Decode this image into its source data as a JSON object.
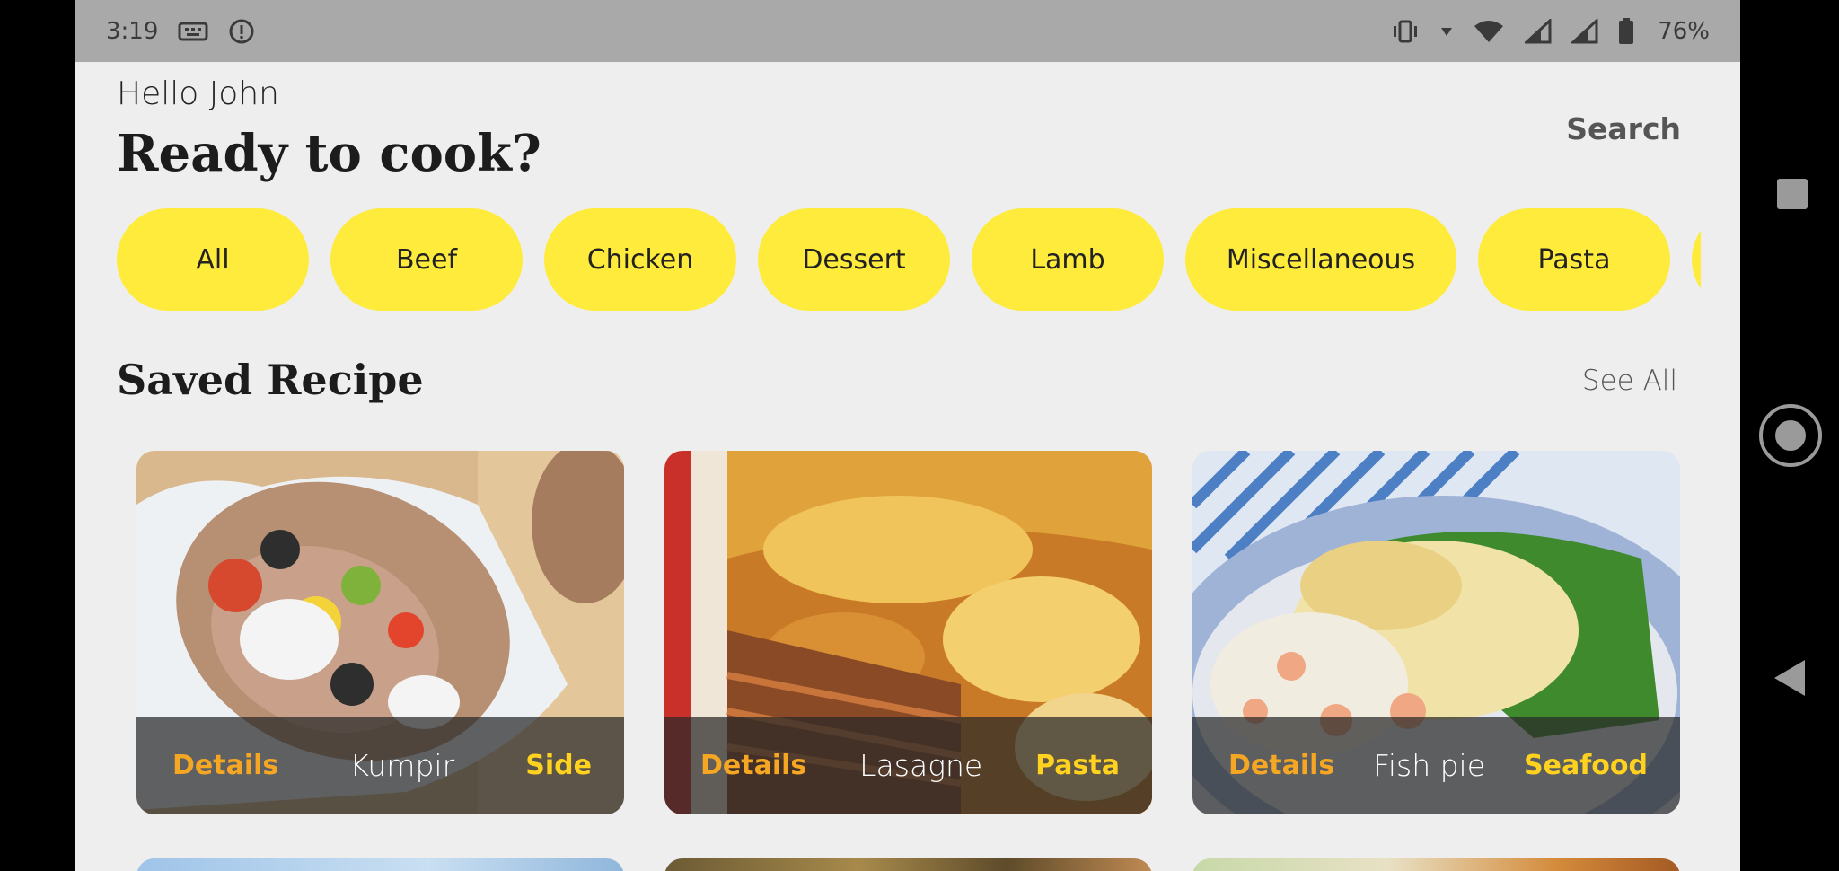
{
  "status_bar": {
    "time": "3:19",
    "battery_percent": "76%",
    "icons": [
      "keyboard-icon",
      "info-icon",
      "vibrate-icon",
      "data-arrow-icon",
      "wifi-icon",
      "signal-icon",
      "signal-icon",
      "battery-icon"
    ]
  },
  "header": {
    "greeting": "Hello John",
    "headline": "Ready to cook?",
    "search_label": "Search"
  },
  "categories": {
    "items": [
      "All",
      "Beef",
      "Chicken",
      "Dessert",
      "Lamb",
      "Miscellaneous",
      "Pasta"
    ],
    "chip_color": "#ffeb3b"
  },
  "saved": {
    "title": "Saved Recipe",
    "see_all_label": "See All",
    "cards": [
      {
        "details_label": "Details",
        "name": "Kumpir",
        "category": "Side"
      },
      {
        "details_label": "Details",
        "name": "Lasagne",
        "category": "Pasta"
      },
      {
        "details_label": "Details",
        "name": "Fish pie",
        "category": "Seafood"
      }
    ]
  },
  "colors": {
    "accent_details": "#f5a623",
    "accent_category": "#ffd21f",
    "background": "#eeeeee",
    "status_bar": "#a9a9a9"
  },
  "nav_bar": {
    "icons": [
      "recents-icon",
      "home-icon",
      "back-icon"
    ]
  }
}
